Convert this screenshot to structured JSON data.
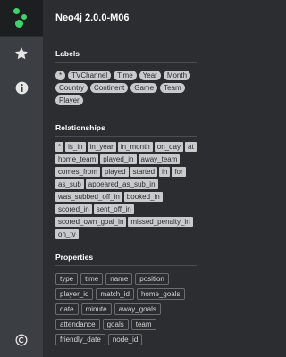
{
  "app": {
    "title": "Neo4j 2.0.0-M06",
    "brand_color": "#3fd36b"
  },
  "sidebar": {
    "items": [
      {
        "icon": "star-icon"
      },
      {
        "icon": "info-icon"
      },
      {
        "icon": "copyright-icon"
      }
    ]
  },
  "labels": {
    "heading": "Labels",
    "items": [
      "*",
      "TVChannel",
      "Time",
      "Year",
      "Month",
      "Country",
      "Continent",
      "Game",
      "Team",
      "Player"
    ]
  },
  "relationships": {
    "heading": "Relationships",
    "items": [
      "*",
      "is_in",
      "in_year",
      "in_month",
      "on_day",
      "at",
      "home_team",
      "played_in",
      "away_team",
      "comes_from",
      "played",
      "started",
      "in",
      "for",
      "as_sub",
      "appeared_as_sub_in",
      "was_subbed_off_in",
      "booked_in",
      "scored_in",
      "sent_off_in",
      "scored_own_goal_in",
      "missed_penalty_in",
      "on_tv"
    ]
  },
  "properties": {
    "heading": "Properties",
    "items": [
      "type",
      "time",
      "name",
      "position",
      "player_id",
      "match_id",
      "home_goals",
      "date",
      "minute",
      "away_goals",
      "attendance",
      "goals",
      "team",
      "friendly_date",
      "node_id"
    ]
  }
}
